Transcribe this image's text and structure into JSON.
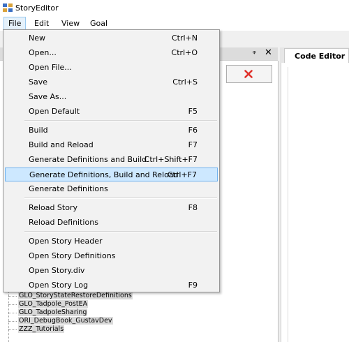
{
  "window": {
    "title": "StoryEditor"
  },
  "menubar": [
    "File",
    "Edit",
    "View",
    "Goal"
  ],
  "file_menu": {
    "groups": [
      [
        {
          "label": "New",
          "shortcut": "Ctrl+N"
        },
        {
          "label": "Open...",
          "shortcut": "Ctrl+O"
        },
        {
          "label": "Open File...",
          "shortcut": ""
        },
        {
          "label": "Save",
          "shortcut": "Ctrl+S"
        },
        {
          "label": "Save As...",
          "shortcut": ""
        },
        {
          "label": "Open Default",
          "shortcut": "F5"
        }
      ],
      [
        {
          "label": "Build",
          "shortcut": "F6"
        },
        {
          "label": "Build and Reload",
          "shortcut": "F7"
        },
        {
          "label": "Generate Definitions and Build",
          "shortcut": "Ctrl+Shift+F7"
        },
        {
          "label": "Generate Definitions, Build and Reload",
          "shortcut": "Ctrl+F7",
          "highlighted": true
        },
        {
          "label": "Generate Definitions",
          "shortcut": ""
        }
      ],
      [
        {
          "label": "Reload Story",
          "shortcut": "F8"
        },
        {
          "label": "Reload Definitions",
          "shortcut": ""
        }
      ],
      [
        {
          "label": "Open Story Header",
          "shortcut": ""
        },
        {
          "label": "Open Story Definitions",
          "shortcut": ""
        },
        {
          "label": "Open Story.div",
          "shortcut": ""
        },
        {
          "label": "Open Story Log",
          "shortcut": "F9"
        }
      ]
    ]
  },
  "panel": {
    "pin_glyph": "ᵠ",
    "close_glyph": "✕"
  },
  "tree": [
    "GLO_StoryStateRestoreDefinitions",
    "GLO_Tadpole_PostEA",
    "GLO_TadpoleSharing",
    "ORI_DebugBook_GustavDev",
    "ZZZ_Tutorials"
  ],
  "tabs": {
    "code_editor": "Code Editor"
  },
  "colors": {
    "highlight": "#cde8ff",
    "delete_red": "#e0332c"
  }
}
